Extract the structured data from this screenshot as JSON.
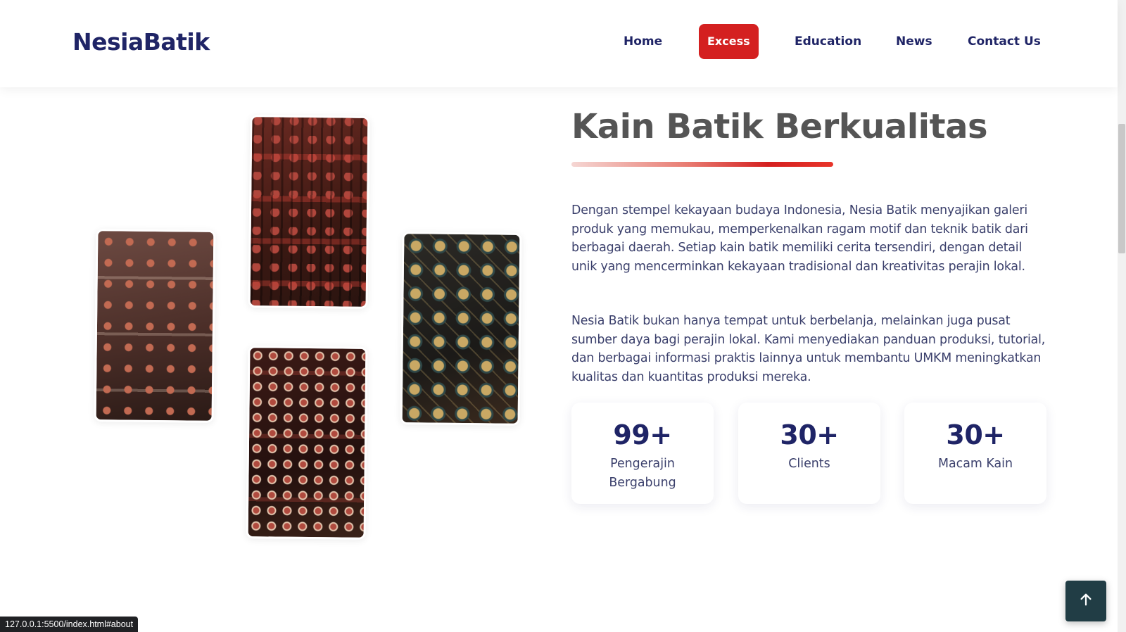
{
  "header": {
    "brand": "NesiaBatik",
    "nav": [
      {
        "label": "Home",
        "active": false
      },
      {
        "label": "Excess",
        "active": true
      },
      {
        "label": "Education",
        "active": false
      },
      {
        "label": "News",
        "active": false
      },
      {
        "label": "Contact Us",
        "active": false
      }
    ]
  },
  "about": {
    "title": "Kain Batik Berkualitas",
    "paragraphs": [
      "Dengan stempel kekayaan budaya Indonesia, Nesia Batik menyajikan galeri produk yang memukau, memperkenalkan ragam motif dan teknik batik dari berbagai daerah. Setiap kain batik memiliki cerita tersendiri, dengan detail unik yang mencerminkan kekayaan tradisional dan kreativitas perajin lokal.",
      "Nesia Batik bukan hanya tempat untuk berbelanja, melainkan juga pusat sumber daya bagi perajin lokal. Kami menyediakan panduan produksi, tutorial, dan berbagai informasi praktis lainnya untuk membantu UMKM meningkatkan kualitas dan kuantitas produksi mereka."
    ],
    "stats": [
      {
        "value": "99+",
        "label": "Pengerajin Bergabung"
      },
      {
        "value": "30+",
        "label": "Clients"
      },
      {
        "value": "30+",
        "label": "Macam Kain"
      }
    ]
  },
  "status_url": "127.0.0.1:5500/index.html#about",
  "colors": {
    "brand": "#1f2466",
    "accent": "#d42020",
    "back_to_top": "#213d45"
  },
  "icons": {
    "back_to_top": "arrow-up-icon"
  }
}
